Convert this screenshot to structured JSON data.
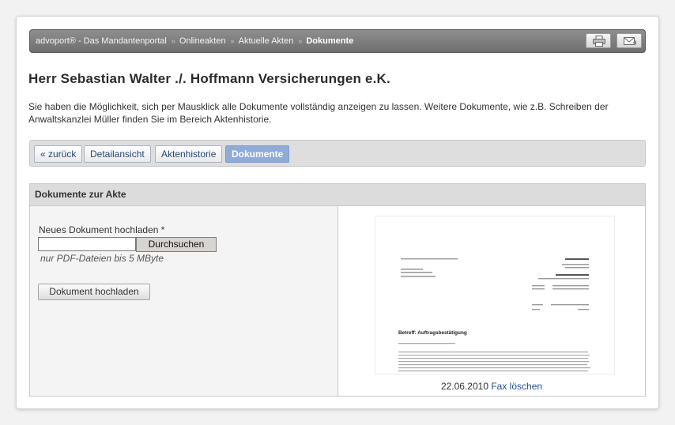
{
  "breadcrumb": {
    "items": [
      "advoport® - Das Mandantenportal",
      "Onlineakten",
      "Aktuelle Akten"
    ],
    "current": "Dokumente",
    "separator": "»"
  },
  "toolbar": {
    "print_icon": "printer-icon",
    "mail_icon": "mail-icon"
  },
  "page": {
    "title": "Herr Sebastian Walter ./. Hoffmann Versicherungen e.K.",
    "intro_line1": "Sie haben die Möglichkeit, sich per Mausklick alle Dokumente vollständig anzeigen zu lassen. Weitere Dokumente, wie z.B. Schreiben der",
    "intro_line2": "Anwaltskanzlei Müller finden Sie im Bereich Aktenhistorie."
  },
  "tabs": {
    "back": "« zurück",
    "detail": "Detailansicht",
    "history": "Aktenhistorie",
    "documents": "Dokumente"
  },
  "panel": {
    "title": "Dokumente zur Akte",
    "upload_label": "Neues Dokument hochladen *",
    "file_input_value": "",
    "browse_label": "Durchsuchen",
    "hint": "nur PDF-Dateien bis 5 MByte",
    "upload_button": "Dokument hochladen"
  },
  "document": {
    "date": "22.06.2010",
    "link": "Fax löschen",
    "subject": "Betreff: Auftragsbestätigung"
  },
  "colors": {
    "accent": "#8fabd8",
    "link": "#1f4e96"
  }
}
